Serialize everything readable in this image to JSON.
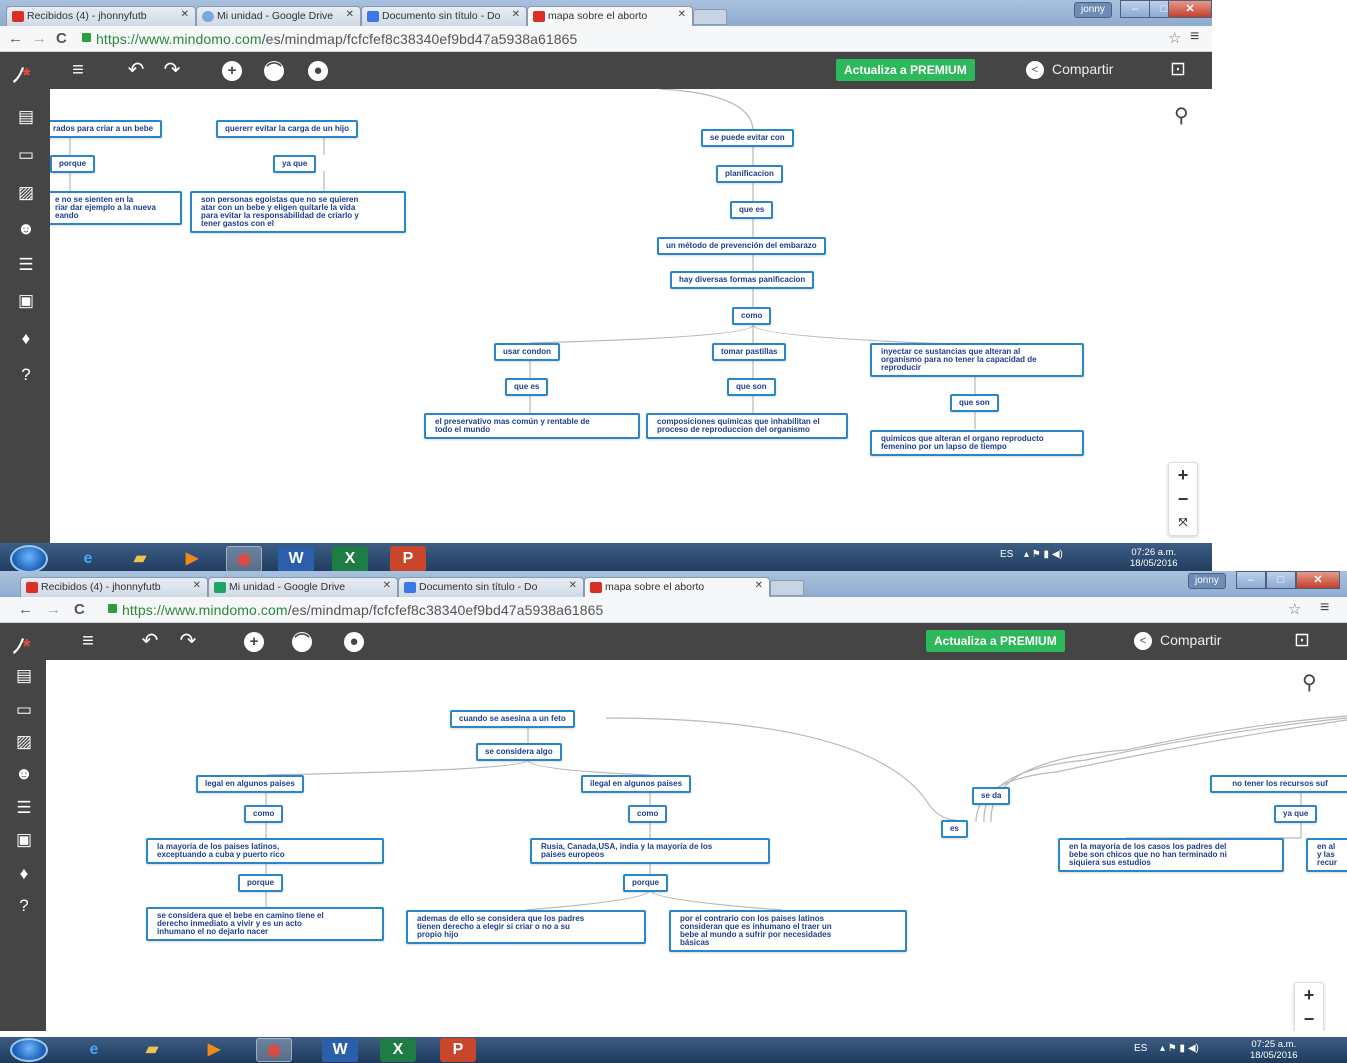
{
  "screenshot_1": {
    "tabs": [
      {
        "label": "Recibidos (4) - jhonnyfutb",
        "icon_color": "#d93025"
      },
      {
        "label": "Mi unidad - Google Drive",
        "icon_color": "#7aa8d8"
      },
      {
        "label": "Documento sin título - Do",
        "icon_color": "#3b78e7"
      },
      {
        "label": "mapa sobre el aborto",
        "icon_color": "#d93025"
      }
    ],
    "user": "jonny",
    "url_host": "https://www.mindomo.com",
    "url_path": "/es/mindmap/fcfcfef8c38340ef9bd47a5938a61865",
    "premium_label": "Actualiza a PREMIUM",
    "share_label": "Compartir",
    "nodes": {
      "a": "rados para criar a un bebe",
      "b": "quererr evitar la carga de un hijo",
      "c": "porque",
      "d": "ya que",
      "e": "e no se sienten en la\nriar  dar ejemplo a la nueva\neando",
      "f": "son personas egoistas que no se quieren\natar con un bebe y eligen quitarle la vida\npara evitar la responsabilidad de criarlo y\ntener gastos con el",
      "g": "se puede evitar con",
      "h": "planificacion",
      "i": "que es",
      "j": "un método de prevención del embarazo",
      "k": "hay diversas formas panificacion",
      "l": "como",
      "m": "usar condon",
      "n": "tomar pastillas",
      "o": "inyectar ce sustancias que alteran al\norganismo para no tener la capacidad de\nreproducir",
      "p": "que  es",
      "q": "que son",
      "r": "que son",
      "s": "el preservativo mas común y rentable de\ntodo el mundo",
      "t": "composiciones quimicas que inhabilitan el\nproceso de reproduccion del organismo",
      "u": "quimicos que alteran el organo  reproducto\nfemenino por un lapso de tiempo"
    },
    "tray_lang": "ES",
    "clock_time": "07:26 a.m.",
    "clock_date": "18/05/2016"
  },
  "screenshot_2": {
    "tabs": [
      {
        "label": "Recibidos (4) - jhonnyfutb",
        "icon_color": "#d93025"
      },
      {
        "label": "Mi unidad - Google Drive",
        "icon_color": "#1fa463"
      },
      {
        "label": "Documento sin título - Do",
        "icon_color": "#3b78e7"
      },
      {
        "label": "mapa sobre el aborto",
        "icon_color": "#d93025"
      }
    ],
    "user": "jonny",
    "url_host": "https://www.mindomo.com",
    "url_path": "/es/mindmap/fcfcfef8c38340ef9bd47a5938a61865",
    "premium_label": "Actualiza a PREMIUM",
    "share_label": "Compartir",
    "nodes": {
      "a": "cuando se asesina a un feto",
      "b": "se considera algo",
      "c": "legal en algunos paises",
      "d": "ilegal en algunos paises",
      "e": "como",
      "f": "como",
      "g": "la mayoría de los paises latinos,\nexceptuando a cuba y puerto rico",
      "h": "Rusia, Canada,USA, india y la mayoría de los\npaises europeos",
      "i": "porque",
      "j": "porque",
      "k": "se considera que el bebe en camino tiene el\nderecho inmediato a vivir y es un acto\ninhumano el no dejarlo nacer",
      "l": "ademas de ello se considera que los padres\ntienen derecho a elegir si criar o no a su\npropio hijo",
      "m": "por el contrario con los paises latinos\nconsideran que es inhumano el traer un\nbebe al mundo a sufrir por necesidades\nbásicas",
      "n": "es",
      "o": "se da",
      "p": "no tener los recursos suf",
      "q": "ya que",
      "r": "en la mayoría de los casos los padres del\nbebe son chicos que no han terminado ni\nsiquiera sus estudios",
      "s": "en al\ny las\nrecur"
    },
    "tray_lang": "ES",
    "clock_time": "07:25 a.m.",
    "clock_date": "18/05/2016"
  }
}
